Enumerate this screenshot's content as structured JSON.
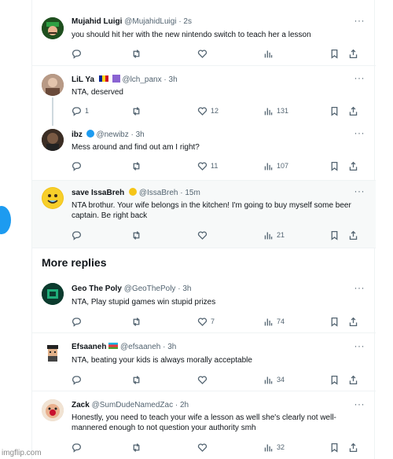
{
  "tweets": [
    {
      "name": "Mujahid Luigi",
      "handle": "@MujahidLuigi",
      "time": "· 2s",
      "text": "you should hit her with the new nintendo switch to teach her a lesson",
      "reply_count": "",
      "like_count": "",
      "view_count": "",
      "avatar_color": "#2f6b2f",
      "avatar_icon": "luigi-avatar"
    },
    {
      "name": "LiL Ya",
      "handle": "@lch_panx",
      "time": "· 3h",
      "text": "NTA, deserved",
      "reply_count": "1",
      "like_count": "12",
      "view_count": "131",
      "avatar_color": "#8a6a5a",
      "avatar_icon": "user-photo-avatar"
    },
    {
      "name": "ibz",
      "handle": "@newibz",
      "time": "· 3h",
      "text": "Mess around and find out am I right?",
      "reply_count": "",
      "like_count": "11",
      "view_count": "107",
      "avatar_color": "#5b4636",
      "avatar_icon": "user-photo-avatar"
    },
    {
      "name": "save IssaBreh",
      "handle": "@IssaBreh",
      "time": "· 15m",
      "text": "NTA brothur. Your wife belongs in the kitchen! I'm going to buy myself some beer captain. Be right back",
      "reply_count": "",
      "like_count": "",
      "view_count": "21",
      "avatar_color": "#f2c318",
      "avatar_icon": "emoji-avatar"
    },
    {
      "name": "Geo The Poly",
      "handle": "@GeoThePoly",
      "time": "· 3h",
      "text": "NTA, Play stupid games win stupid prizes",
      "reply_count": "",
      "like_count": "7",
      "view_count": "74",
      "avatar_color": "#0e4d3a",
      "avatar_icon": "logo-avatar"
    },
    {
      "name": "Efsaaneh",
      "handle": "@efsaaneh",
      "time": "· 3h",
      "text": "NTA, beating your kids is always morally acceptable",
      "reply_count": "",
      "like_count": "",
      "view_count": "34",
      "avatar_color": "#444444",
      "avatar_icon": "pixel-avatar"
    },
    {
      "name": "Zack",
      "handle": "@SumDudeNamedZac",
      "time": "· 2h",
      "text": "Honestly, you need to teach your wife a lesson as well she's clearly not well-mannered enough to not question your authority smh",
      "reply_count": "",
      "like_count": "",
      "view_count": "32",
      "avatar_color": "#d9b9a0",
      "avatar_icon": "face-avatar"
    }
  ],
  "section": {
    "more_replies": "More replies"
  },
  "watermark": "imgflip.com",
  "icons": {
    "reply": "reply-icon",
    "retweet": "retweet-icon",
    "like": "heart-icon",
    "views": "views-icon",
    "bookmark": "bookmark-icon",
    "share": "share-icon",
    "more": "more-icon"
  },
  "colors": {
    "accent": "#1d9bf0",
    "muted": "#536471",
    "text": "#0f1419",
    "highlight_bg": "#f7f9f9"
  }
}
